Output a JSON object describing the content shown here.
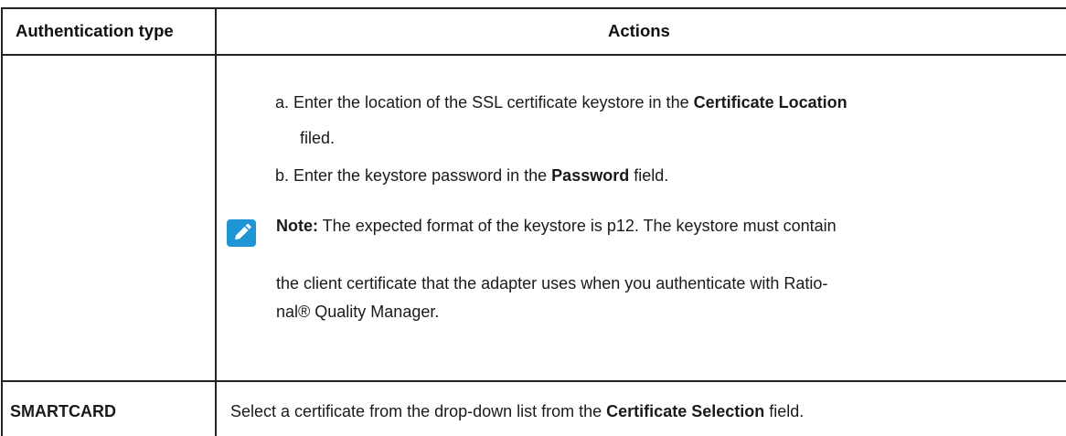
{
  "table": {
    "headers": {
      "auth_type": "Authentication type",
      "actions": "Actions"
    },
    "row1": {
      "step_a": {
        "prefix": "a. Enter the location of the SSL certificate keystore in the ",
        "bold": "Certificate Location",
        "line2": "filed."
      },
      "step_b": {
        "prefix": "b. Enter the keystore password in the ",
        "bold": "Password",
        "suffix": " field."
      },
      "note": {
        "label": "Note:",
        "line1": " The expected format of the keystore is p12. The keystore must contain",
        "line2": "the client certificate that the adapter uses when you authenticate with Ratio-",
        "line3": "nal® Quality Manager."
      }
    },
    "row2": {
      "auth_type": "SMARTCARD",
      "prefix": "Select a certificate from the drop-down list from the ",
      "bold": "Certificate Selection",
      "suffix": " field."
    }
  },
  "colors": {
    "note_icon": "#1f95d6",
    "border": "#222222"
  },
  "icons": {
    "note": "pencil-note-icon"
  }
}
